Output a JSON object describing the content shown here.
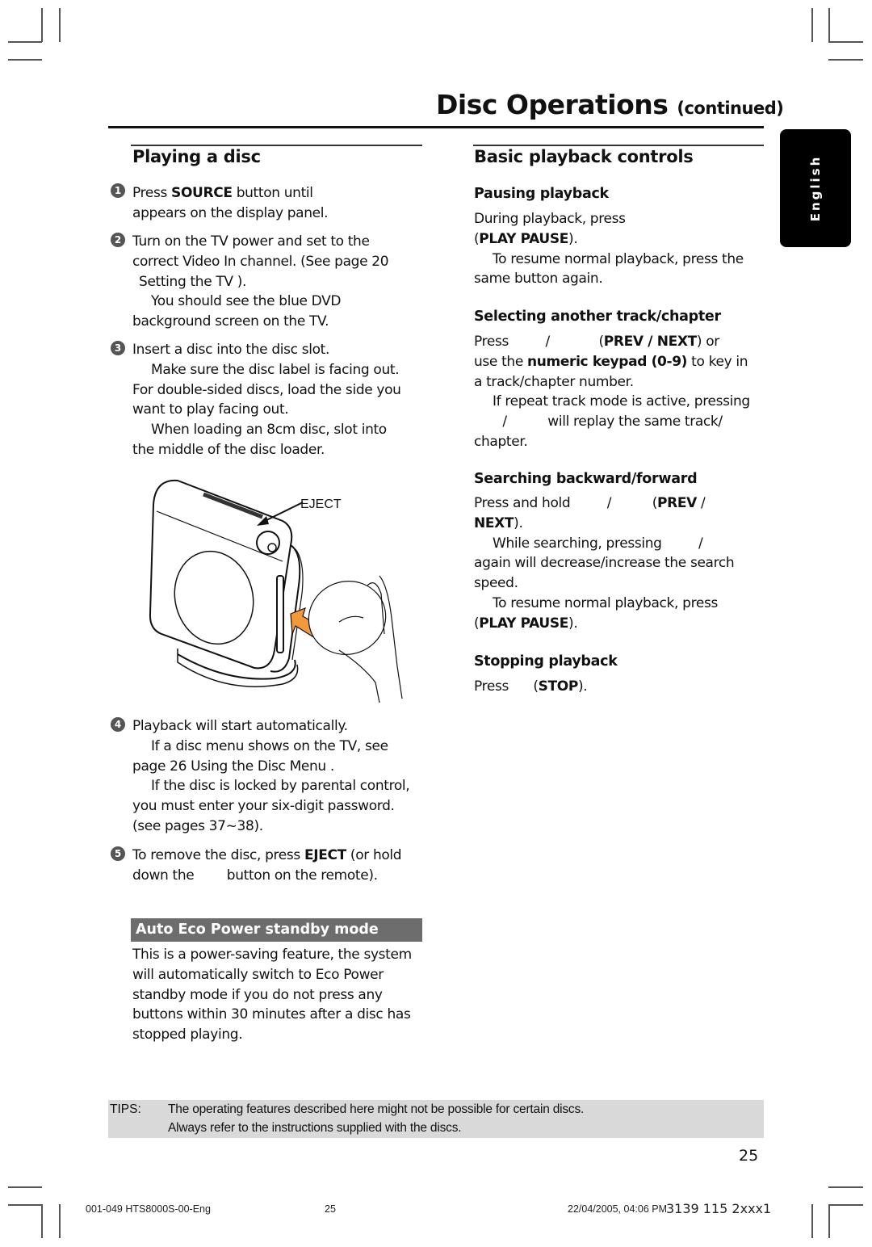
{
  "header": {
    "title": "Disc Operations",
    "title_suffix": "(continued)"
  },
  "language_tab": {
    "label": "English"
  },
  "left": {
    "heading": "Playing a disc",
    "steps": [
      {
        "number": "1",
        "lines": [
          {
            "pre": "Press ",
            "bold": "SOURCE",
            "post": " button until"
          },
          {
            "text": "appears on the display panel."
          }
        ]
      },
      {
        "number": "2",
        "lines": [
          {
            "text": "Turn on the TV power and set to the"
          },
          {
            "text": "correct Video In channel.  (See page 20"
          },
          {
            "text": " Setting the TV  )."
          },
          {
            "text": "You should see the blue DVD"
          },
          {
            "text": "background screen on the TV."
          }
        ]
      },
      {
        "number": "3",
        "lines": [
          {
            "text": "Insert a disc into the disc slot."
          },
          {
            "text": "Make sure the disc label is facing out."
          },
          {
            "text": "For double-sided discs, load the side you"
          },
          {
            "text": "want to play facing out."
          },
          {
            "text": "When loading an 8cm disc, slot into"
          },
          {
            "text": "the middle of the disc loader."
          }
        ]
      },
      {
        "number": "4",
        "lines": [
          {
            "text": "Playback will start automatically."
          },
          {
            "text": "If a disc menu shows on the TV, see"
          },
          {
            "text": "page 26  Using the Disc Menu  ."
          },
          {
            "text": "If the disc is locked by parental control,"
          },
          {
            "text": "you must enter your six-digit password."
          },
          {
            "text": "(see pages 37~38)."
          }
        ]
      },
      {
        "number": "5",
        "lines": [
          {
            "pre": "To remove the disc, press ",
            "bold": "EJECT",
            "post": " (or hold"
          },
          {
            "text": "down the        button on the remote)."
          }
        ]
      }
    ],
    "figure": {
      "eject_label": "EJECT"
    },
    "eco": {
      "heading": "Auto Eco Power standby mode",
      "lines": [
        "This is a power-saving feature, the system",
        "will automatically switch to Eco Power",
        "standby mode if you do not press any",
        "buttons within 30 minutes after a disc has",
        "stopped playing."
      ]
    }
  },
  "right": {
    "heading": "Basic playback controls",
    "sections": [
      {
        "title": "Pausing playback",
        "lines": [
          {
            "text": "During playback, press"
          },
          {
            "pre": "(",
            "bold": "PLAY PAUSE",
            "post": ")."
          },
          {
            "text": "To resume normal playback, press the"
          },
          {
            "text": "same button again."
          }
        ]
      },
      {
        "title": "Selecting another track/chapter",
        "lines": [
          {
            "pre": "Press         /            (",
            "bold": "PREV / NEXT",
            "post": ") or"
          },
          {
            "pre": "use the ",
            "bold": "numeric keypad (0-9)",
            "post": " to key in"
          },
          {
            "text": "a track/chapter number."
          },
          {
            "text": "If repeat track mode is active, pressing"
          },
          {
            "text": "       /          will replay the same track/"
          },
          {
            "text": "chapter."
          }
        ]
      },
      {
        "title": "Searching backward/forward",
        "lines": [
          {
            "pre": "Press and hold         /          (",
            "bold": "PREV",
            "post": " /"
          },
          {
            "pre": "",
            "bold": "NEXT",
            "post": ")."
          },
          {
            "text": "While searching, pressing         /"
          },
          {
            "text": "again will decrease/increase the search"
          },
          {
            "text": "speed."
          },
          {
            "text": "To resume normal playback, press"
          },
          {
            "pre": "(",
            "bold": "PLAY PAUSE",
            "post": ")."
          }
        ]
      },
      {
        "title": "Stopping playback",
        "lines": [
          {
            "pre": "Press      (",
            "bold": "STOP",
            "post": ")."
          }
        ]
      }
    ]
  },
  "tips": {
    "label": "TIPS:",
    "lines": [
      "The operating features described here might not be possible for certain discs.",
      "Always refer to the instructions supplied with the discs."
    ]
  },
  "page_number": "25",
  "footer": {
    "file": "001-049 HTS8000S-00-Eng",
    "page": "25",
    "datetime": "22/04/2005, 04:06 PM",
    "code": "3139 115 2xxx1"
  }
}
